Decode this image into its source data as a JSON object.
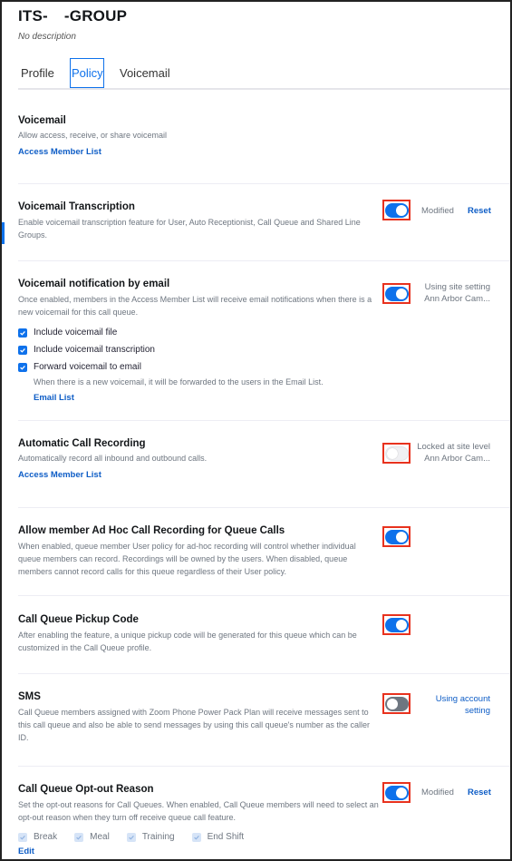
{
  "header": {
    "title_part1": "ITS-",
    "title_part2": "-GROUP",
    "description": "No description"
  },
  "tabs": [
    {
      "label": "Profile",
      "active": false
    },
    {
      "label": "Policy",
      "active": true
    },
    {
      "label": "Voicemail",
      "active": false
    }
  ],
  "colors": {
    "accent": "#0e71eb",
    "link": "#0e5dc6",
    "highlight_box": "#e8321e"
  },
  "sections": {
    "voicemail": {
      "title": "Voicemail",
      "description": "Allow access, receive, or share voicemail",
      "link": "Access Member List"
    },
    "transcription": {
      "title": "Voicemail Transcription",
      "description": "Enable voicemail transcription feature for User, Auto Receptionist, Call Queue and Shared Line Groups.",
      "enabled": true,
      "status": "Modified",
      "reset": "Reset"
    },
    "notification": {
      "title": "Voicemail notification by email",
      "description": "Once enabled, members in the Access Member List will receive email notifications when there is a new voicemail for this call queue.",
      "enabled": true,
      "status_line1": "Using site setting",
      "status_line2": "Ann Arbor Cam...",
      "checkboxes": [
        {
          "label": "Include voicemail file",
          "checked": true
        },
        {
          "label": "Include voicemail transcription",
          "checked": true
        },
        {
          "label": "Forward voicemail to email",
          "checked": true
        }
      ],
      "forward_note": "When there is a new voicemail, it will be forwarded to the users in the Email List.",
      "email_link": "Email List"
    },
    "auto_recording": {
      "title": "Automatic Call Recording",
      "description": "Automatically record all inbound and outbound calls.",
      "enabled": false,
      "status_line1": "Locked at site level",
      "status_line2": "Ann Arbor Cam...",
      "link": "Access Member List"
    },
    "adhoc": {
      "title": "Allow member Ad Hoc Call Recording for Queue Calls",
      "description": "When enabled, queue member User policy for ad-hoc recording will control whether individual queue members can record. Recordings will be owned by the users. When disabled, queue members cannot record calls for this queue regardless of their User policy.",
      "enabled": true
    },
    "pickup": {
      "title": "Call Queue Pickup Code",
      "description": "After enabling the feature, a unique pickup code will be generated for this queue which can be customized in the Call Queue profile.",
      "enabled": true
    },
    "sms": {
      "title": "SMS",
      "description": "Call Queue members assigned with Zoom Phone Power Pack Plan will receive messages sent to this call queue and also be able to send messages by using this call queue's number as the caller ID.",
      "enabled": false,
      "status_line1": "Using account",
      "status_line2": "setting"
    },
    "optout": {
      "title": "Call Queue Opt-out Reason",
      "description": "Set the opt-out reasons for Call Queues. When enabled, Call Queue members will need to select an opt-out reason when they turn off receive queue call feature.",
      "enabled": true,
      "status": "Modified",
      "reset": "Reset",
      "reasons": [
        {
          "label": "Break",
          "checked": true
        },
        {
          "label": "Meal",
          "checked": true
        },
        {
          "label": "Training",
          "checked": true
        },
        {
          "label": "End Shift",
          "checked": true
        }
      ],
      "edit": "Edit"
    }
  }
}
